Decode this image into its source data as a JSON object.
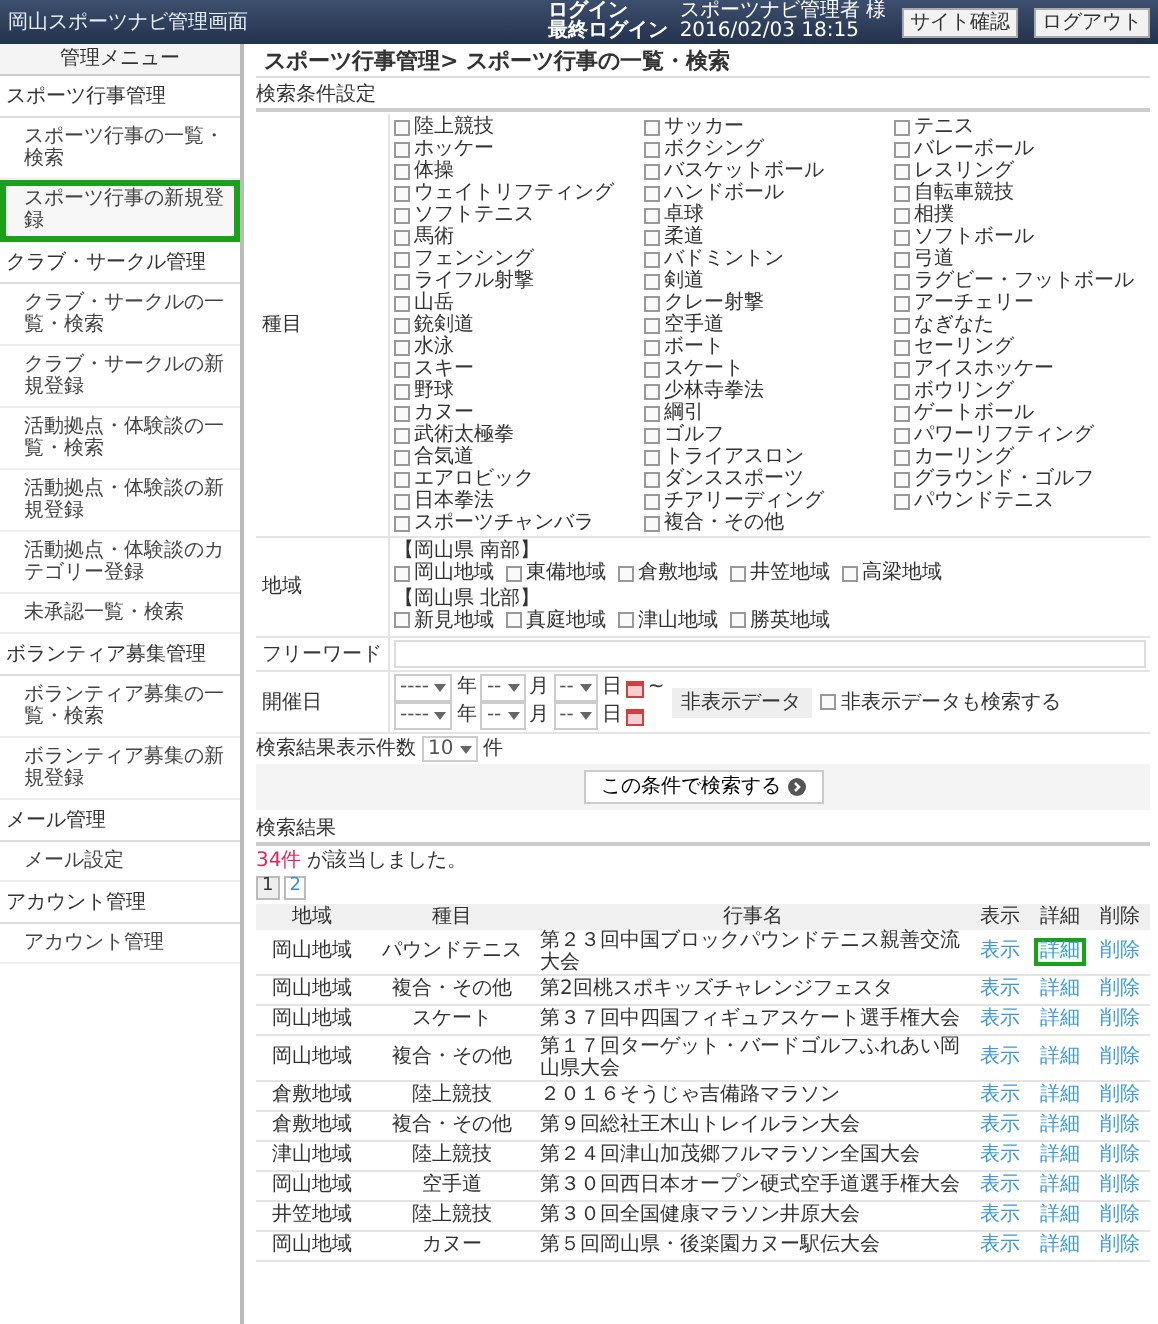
{
  "header": {
    "title": "岡山スポーツナビ管理画面",
    "login_label": "ログイン",
    "user": "スポーツナビ管理者 様",
    "last_login_label": "最終ログイン",
    "last_login": "2016/02/03 18:15",
    "buttons": [
      "サイト確認",
      "ログアウト"
    ]
  },
  "sidebar": {
    "title": "管理メニュー",
    "sections": [
      {
        "label": "スポーツ行事管理",
        "items": [
          {
            "label": "スポーツ行事の一覧・検索",
            "selected": false
          },
          {
            "label": "スポーツ行事の新規登録",
            "selected": true
          }
        ]
      },
      {
        "label": "クラブ・サークル管理",
        "items": [
          {
            "label": "クラブ・サークルの一覧・検索",
            "selected": false
          },
          {
            "label": "クラブ・サークルの新規登録",
            "selected": false
          },
          {
            "label": "活動拠点・体験談の一覧・検索",
            "selected": false
          },
          {
            "label": "活動拠点・体験談の新規登録",
            "selected": false
          },
          {
            "label": "活動拠点・体験談のカテゴリー登録",
            "selected": false
          },
          {
            "label": "未承認一覧・検索",
            "selected": false
          }
        ]
      },
      {
        "label": "ボランティア募集管理",
        "items": [
          {
            "label": "ボランティア募集の一覧・検索",
            "selected": false
          },
          {
            "label": "ボランティア募集の新規登録",
            "selected": false
          }
        ]
      },
      {
        "label": "メール管理",
        "items": [
          {
            "label": "メール設定",
            "selected": false
          }
        ]
      },
      {
        "label": "アカウント管理",
        "items": [
          {
            "label": "アカウント管理",
            "selected": false
          }
        ]
      }
    ]
  },
  "breadcrumb": "スポーツ行事管理> スポーツ行事の一覧・検索",
  "search": {
    "title": "検索条件設定",
    "sports": {
      "label": "種目",
      "options": [
        {
          "label": "陸上競技",
          "checked": false
        },
        {
          "label": "サッカー",
          "checked": false
        },
        {
          "label": "テニス",
          "checked": false
        },
        {
          "label": "ホッケー",
          "checked": false
        },
        {
          "label": "ボクシング",
          "checked": false
        },
        {
          "label": "バレーボール",
          "checked": false
        },
        {
          "label": "体操",
          "checked": false
        },
        {
          "label": "バスケットボール",
          "checked": false
        },
        {
          "label": "レスリング",
          "checked": false
        },
        {
          "label": "ウェイトリフティング",
          "checked": false
        },
        {
          "label": "ハンドボール",
          "checked": false
        },
        {
          "label": "自転車競技",
          "checked": false
        },
        {
          "label": "ソフトテニス",
          "checked": false
        },
        {
          "label": "卓球",
          "checked": false
        },
        {
          "label": "相撲",
          "checked": false
        },
        {
          "label": "馬術",
          "checked": false
        },
        {
          "label": "柔道",
          "checked": false
        },
        {
          "label": "ソフトボール",
          "checked": false
        },
        {
          "label": "フェンシング",
          "checked": false
        },
        {
          "label": "バドミントン",
          "checked": false
        },
        {
          "label": "弓道",
          "checked": false
        },
        {
          "label": "ライフル射撃",
          "checked": false
        },
        {
          "label": "剣道",
          "checked": false
        },
        {
          "label": "ラグビー・フットボール",
          "checked": false
        },
        {
          "label": "山岳",
          "checked": false
        },
        {
          "label": "クレー射撃",
          "checked": false
        },
        {
          "label": "アーチェリー",
          "checked": false
        },
        {
          "label": "銃剣道",
          "checked": false
        },
        {
          "label": "空手道",
          "checked": false
        },
        {
          "label": "なぎなた",
          "checked": false
        },
        {
          "label": "水泳",
          "checked": false
        },
        {
          "label": "ボート",
          "checked": false
        },
        {
          "label": "セーリング",
          "checked": false
        },
        {
          "label": "スキー",
          "checked": false
        },
        {
          "label": "スケート",
          "checked": false
        },
        {
          "label": "アイスホッケー",
          "checked": false
        },
        {
          "label": "野球",
          "checked": false
        },
        {
          "label": "少林寺拳法",
          "checked": false
        },
        {
          "label": "ボウリング",
          "checked": false
        },
        {
          "label": "カヌー",
          "checked": false
        },
        {
          "label": "綱引",
          "checked": false
        },
        {
          "label": "ゲートボール",
          "checked": false
        },
        {
          "label": "武術太極拳",
          "checked": false
        },
        {
          "label": "ゴルフ",
          "checked": false
        },
        {
          "label": "パワーリフティング",
          "checked": false
        },
        {
          "label": "合気道",
          "checked": false
        },
        {
          "label": "トライアスロン",
          "checked": false
        },
        {
          "label": "カーリング",
          "checked": false
        },
        {
          "label": "エアロビック",
          "checked": false
        },
        {
          "label": "ダンススポーツ",
          "checked": false
        },
        {
          "label": "グラウンド・ゴルフ",
          "checked": false
        },
        {
          "label": "日本拳法",
          "checked": false
        },
        {
          "label": "チアリーディング",
          "checked": false
        },
        {
          "label": "パウンドテニス",
          "checked": false
        },
        {
          "label": "スポーツチャンバラ",
          "checked": false
        },
        {
          "label": "複合・その他",
          "checked": false
        }
      ]
    },
    "area": {
      "label": "地域",
      "groups": [
        {
          "heading": "【岡山県 南部】",
          "options": [
            {
              "label": "岡山地域",
              "checked": false
            },
            {
              "label": "東備地域",
              "checked": false
            },
            {
              "label": "倉敷地域",
              "checked": false
            },
            {
              "label": "井笠地域",
              "checked": false
            },
            {
              "label": "高梁地域",
              "checked": false
            }
          ]
        },
        {
          "heading": "【岡山県 北部】",
          "options": [
            {
              "label": "新見地域",
              "checked": false
            },
            {
              "label": "真庭地域",
              "checked": false
            },
            {
              "label": "津山地域",
              "checked": false
            },
            {
              "label": "勝英地域",
              "checked": false
            }
          ]
        }
      ]
    },
    "freeword": {
      "label": "フリーワード"
    },
    "date": {
      "label": "開催日",
      "rows": [
        {
          "year": "----",
          "year_unit": "年",
          "month": "--",
          "month_unit": "月",
          "day": "--",
          "day_unit": "日",
          "separator": "~"
        },
        {
          "year": "----",
          "year_unit": "年",
          "month": "--",
          "month_unit": "月",
          "day": "--",
          "day_unit": "日"
        }
      ]
    },
    "hidden": {
      "label": "非表示データ",
      "option": {
        "label": "非表示データも検索する",
        "checked": false
      }
    },
    "page_size": {
      "label": "検索結果表示件数",
      "value": "10",
      "unit": "件"
    },
    "submit": "この条件で検索する"
  },
  "results": {
    "title": "検索結果",
    "count": "34件",
    "count_text": "が該当しました。",
    "pages": [
      {
        "label": "1",
        "selected": true
      },
      {
        "label": "2",
        "selected": false
      }
    ],
    "columns": [
      "地域",
      "種目",
      "行事名",
      "表示",
      "詳細",
      "削除"
    ],
    "rows": [
      {
        "area": "岡山地域",
        "sport": "パウンドテニス",
        "name": "第２３回中国ブロックパウンドテニス親善交流大会",
        "actions": [
          {
            "label": "表示",
            "highlighted": false
          },
          {
            "label": "詳細",
            "highlighted": true
          },
          {
            "label": "削除",
            "highlighted": false
          }
        ]
      },
      {
        "area": "岡山地域",
        "sport": "複合・その他",
        "name": "第2回桃スポキッズチャレンジフェスタ",
        "actions": [
          {
            "label": "表示",
            "highlighted": false
          },
          {
            "label": "詳細",
            "highlighted": false
          },
          {
            "label": "削除",
            "highlighted": false
          }
        ]
      },
      {
        "area": "岡山地域",
        "sport": "スケート",
        "name": "第３７回中四国フィギュアスケート選手権大会",
        "actions": [
          {
            "label": "表示",
            "highlighted": false
          },
          {
            "label": "詳細",
            "highlighted": false
          },
          {
            "label": "削除",
            "highlighted": false
          }
        ]
      },
      {
        "area": "岡山地域",
        "sport": "複合・その他",
        "name": "第１７回ターゲット・バードゴルフふれあい岡山県大会",
        "actions": [
          {
            "label": "表示",
            "highlighted": false
          },
          {
            "label": "詳細",
            "highlighted": false
          },
          {
            "label": "削除",
            "highlighted": false
          }
        ]
      },
      {
        "area": "倉敷地域",
        "sport": "陸上競技",
        "name": "２０１６そうじゃ吉備路マラソン",
        "actions": [
          {
            "label": "表示",
            "highlighted": false
          },
          {
            "label": "詳細",
            "highlighted": false
          },
          {
            "label": "削除",
            "highlighted": false
          }
        ]
      },
      {
        "area": "倉敷地域",
        "sport": "複合・その他",
        "name": "第９回総社王木山トレイルラン大会",
        "actions": [
          {
            "label": "表示",
            "highlighted": false
          },
          {
            "label": "詳細",
            "highlighted": false
          },
          {
            "label": "削除",
            "highlighted": false
          }
        ]
      },
      {
        "area": "津山地域",
        "sport": "陸上競技",
        "name": "第２４回津山加茂郷フルマラソン全国大会",
        "actions": [
          {
            "label": "表示",
            "highlighted": false
          },
          {
            "label": "詳細",
            "highlighted": false
          },
          {
            "label": "削除",
            "highlighted": false
          }
        ]
      },
      {
        "area": "岡山地域",
        "sport": "空手道",
        "name": "第３０回西日本オープン硬式空手道選手権大会",
        "actions": [
          {
            "label": "表示",
            "highlighted": false
          },
          {
            "label": "詳細",
            "highlighted": false
          },
          {
            "label": "削除",
            "highlighted": false
          }
        ]
      },
      {
        "area": "井笠地域",
        "sport": "陸上競技",
        "name": "第３０回全国健康マラソン井原大会",
        "actions": [
          {
            "label": "表示",
            "highlighted": false
          },
          {
            "label": "詳細",
            "highlighted": false
          },
          {
            "label": "削除",
            "highlighted": false
          }
        ]
      },
      {
        "area": "岡山地域",
        "sport": "カヌー",
        "name": "第５回岡山県・後楽園カヌー駅伝大会",
        "actions": [
          {
            "label": "表示",
            "highlighted": false
          },
          {
            "label": "詳細",
            "highlighted": false
          },
          {
            "label": "削除",
            "highlighted": false
          }
        ]
      }
    ]
  }
}
